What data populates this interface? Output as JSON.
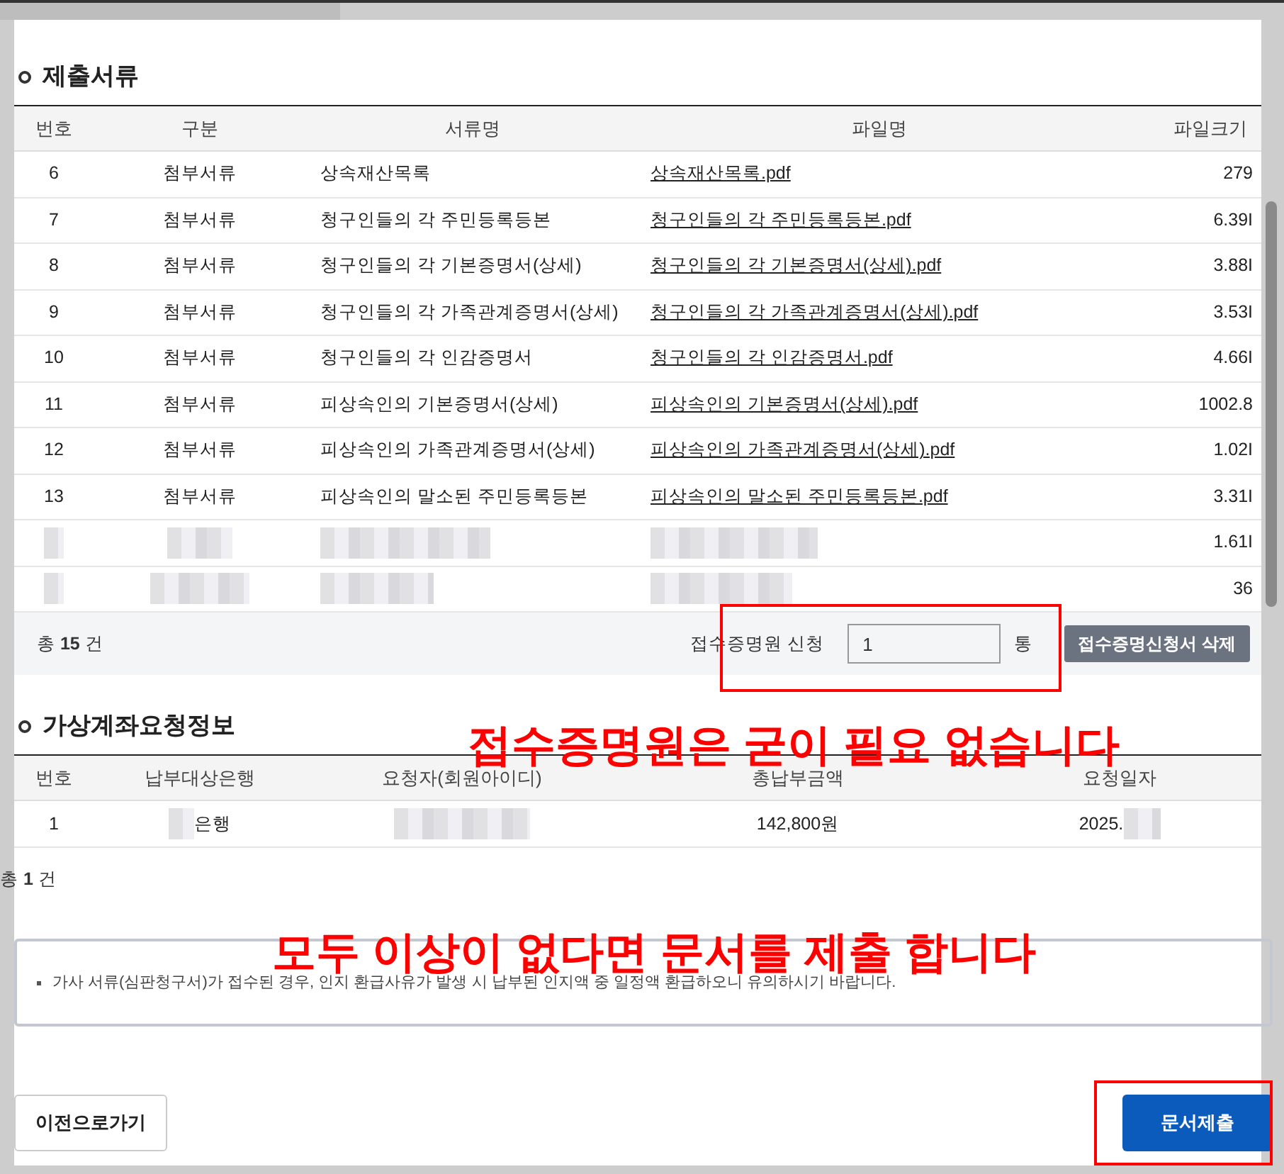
{
  "documents": {
    "title": "제출서류",
    "columns": [
      "번호",
      "구분",
      "서류명",
      "파일명",
      "파일크기"
    ],
    "rows": [
      {
        "no": "6",
        "category": "첨부서류",
        "name": "상속재산목록",
        "file": "상속재산목록.pdf",
        "size": "279"
      },
      {
        "no": "7",
        "category": "첨부서류",
        "name": "청구인들의 각 주민등록등본",
        "file": "청구인들의 각 주민등록등본.pdf",
        "size": "6.39I"
      },
      {
        "no": "8",
        "category": "첨부서류",
        "name": "청구인들의 각 기본증명서(상세)",
        "file": "청구인들의 각 기본증명서(상세).pdf",
        "size": "3.88I"
      },
      {
        "no": "9",
        "category": "첨부서류",
        "name": "청구인들의 각 가족관계증명서(상세)",
        "file": "청구인들의 각 가족관계증명서(상세).pdf",
        "size": "3.53I"
      },
      {
        "no": "10",
        "category": "첨부서류",
        "name": "청구인들의 각 인감증명서",
        "file": "청구인들의 각 인감증명서.pdf",
        "size": "4.66I"
      },
      {
        "no": "11",
        "category": "첨부서류",
        "name": "피상속인의 기본증명서(상세)",
        "file": "피상속인의 기본증명서(상세).pdf",
        "size": "1002.8"
      },
      {
        "no": "12",
        "category": "첨부서류",
        "name": "피상속인의 가족관계증명서(상세)",
        "file": "피상속인의 가족관계증명서(상세).pdf",
        "size": "1.02I"
      },
      {
        "no": "13",
        "category": "첨부서류",
        "name": "피상속인의 말소된 주민등록등본",
        "file": "피상속인의 말소된 주민등록등본.pdf",
        "size": "3.31I"
      },
      {
        "redacted": true,
        "size": "1.61I"
      },
      {
        "redacted": true,
        "size": "36"
      }
    ],
    "total_prefix": "총",
    "total_count": "15",
    "total_suffix": "건",
    "receipt_label": "접수증명원 신청",
    "receipt_value": "1",
    "receipt_unit": "통",
    "delete_button": "접수증명신청서 삭제"
  },
  "virtual_account": {
    "title": "가상계좌요청정보",
    "columns": [
      "번호",
      "납부대상은행",
      "요청자(회원아이디)",
      "총납부금액",
      "요청일자"
    ],
    "rows": [
      {
        "no": "1",
        "bank": "은행",
        "amount": "142,800원",
        "date": "2025."
      }
    ],
    "total_prefix": "총",
    "total_count": "1",
    "total_suffix": "건"
  },
  "notice": "가사 서류(심판청구서)가 접수된 경우, 인지 환급사유가 발생 시 납부된 인지액 중 일정액 환급하오니 유의하시기 바랍니다.",
  "buttons": {
    "back": "이전으로가기",
    "submit": "문서제출"
  },
  "annotations": [
    {
      "text": "접수증명원은 굳이 필요 없습니다"
    },
    {
      "text": "모두 이상이 없다면 문서를 제출 합니다"
    }
  ]
}
